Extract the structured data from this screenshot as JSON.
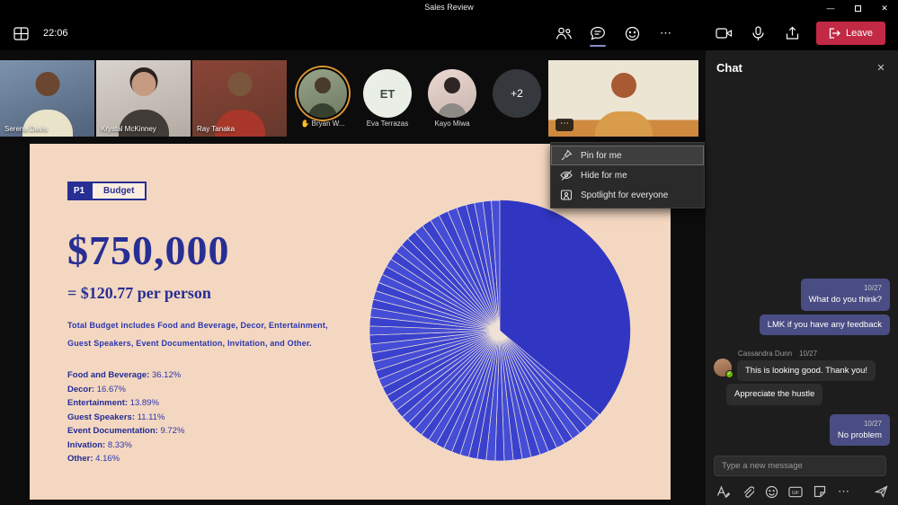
{
  "window": {
    "title": "Sales Review"
  },
  "icons": {
    "minimize": "—",
    "close": "✕",
    "ellipsis": "⋯"
  },
  "toolbar": {
    "time": "22:06",
    "leave_label": "Leave"
  },
  "participants": [
    {
      "name": "Serena Davis"
    },
    {
      "name": "Krystal McKinney"
    },
    {
      "name": "Ray Tanaka"
    },
    {
      "name": "Bryan W...",
      "hand": "✋"
    },
    {
      "name": "Eva Terrazas",
      "initials": "ET"
    },
    {
      "name": "Kayo Miwa"
    },
    {
      "name": "+2"
    }
  ],
  "context_menu": {
    "items": [
      {
        "label": "Pin for me"
      },
      {
        "label": "Hide for me"
      },
      {
        "label": "Spotlight for everyone"
      }
    ]
  },
  "slide": {
    "badge": "P1",
    "tab": "Budget",
    "total": "$750,000",
    "per_person": "= $120.77 per person",
    "desc_line1": "Total Budget includes Food and Beverage, Decor, Entertainment,",
    "desc_line2": "Guest Speakers, Event Documentation, Invitation, and Other.",
    "breakdown": [
      {
        "label": "Food and Beverage:",
        "value": "36.12%"
      },
      {
        "label": "Decor:",
        "value": "16.67%"
      },
      {
        "label": "Entertainment:",
        "value": "13.89%"
      },
      {
        "label": "Guest Speakers:",
        "value": "11.11%"
      },
      {
        "label": "Event Documentation:",
        "value": "9.72%"
      },
      {
        "label": "Inivation:",
        "value": "8.33%"
      },
      {
        "label": "Other:",
        "value": "4.16%"
      }
    ]
  },
  "chart_data": {
    "type": "pie",
    "title": "Event budget breakdown",
    "labels": [
      "Food and Beverage",
      "Decor",
      "Entertainment",
      "Guest Speakers",
      "Event Documentation",
      "Inivation",
      "Other"
    ],
    "values": [
      36.12,
      16.67,
      13.89,
      11.11,
      9.72,
      8.33,
      4.16
    ],
    "unit": "%",
    "start_angle_deg": -90,
    "direction": "clockwise",
    "colors": {
      "solid": "#3036c2",
      "base": "#3a41cd",
      "alt": "#454dd6",
      "hairline": "#efe3d6"
    }
  },
  "chat": {
    "title": "Chat",
    "messages": [
      {
        "time": "10/27",
        "text": "What do you think?"
      },
      {
        "text": "LMK if you have any feedback"
      },
      {
        "author": "Cassandra Dunn",
        "time": "10/27",
        "text": "This is looking good. Thank you!"
      },
      {
        "text": "Appreciate the hustle"
      },
      {
        "time": "10/27",
        "text": "No problem"
      }
    ],
    "input_placeholder": "Type a new message"
  }
}
